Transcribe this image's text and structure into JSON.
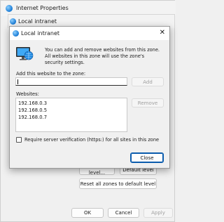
{
  "bg_window": {
    "title": "Internet Properties",
    "buttons": {
      "custom_level": "Custom level...",
      "default_level": "Default level",
      "reset_all": "Reset all zones to default level",
      "ok": "OK",
      "cancel": "Cancel",
      "apply": "Apply"
    }
  },
  "ghost_window": {
    "title": "Local intranet"
  },
  "dialog": {
    "title": "Local intranet",
    "close_glyph": "✕",
    "intro_text": "You can add and remove websites from this zone. All websites in this zone will use the zone's security settings.",
    "add_label": "Add this website to the zone:",
    "add_input_value": "",
    "add_button": "Add",
    "websites_label": "Websites:",
    "websites": [
      "192.168.0.3",
      "192.168.0.5",
      "192.168.0.7"
    ],
    "remove_button": "Remove",
    "require_https_label": "Require server verification (https:) for all sites in this zone",
    "require_https_checked": false,
    "close_button": "Close"
  },
  "colors": {
    "accent": "#0b5cad",
    "window_bg": "#f0f0f0"
  }
}
